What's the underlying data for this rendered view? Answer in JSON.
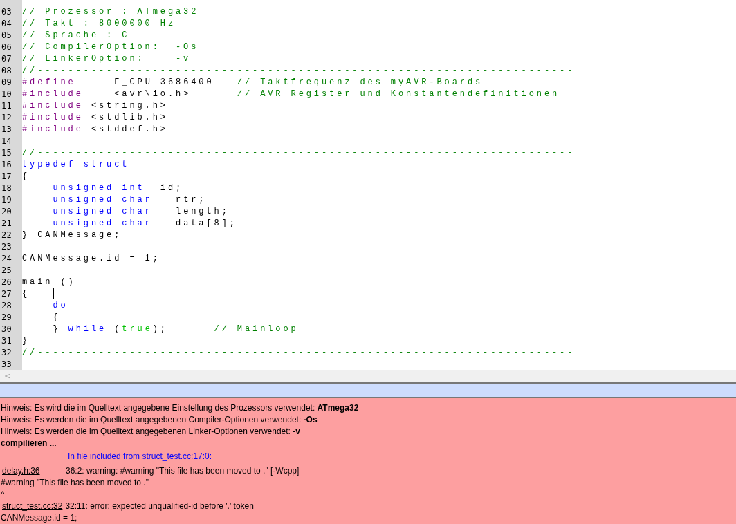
{
  "editor": {
    "lines": [
      {
        "number": "03",
        "cursor": false,
        "tokens": [
          {
            "kind": "comment",
            "text": "// Prozessor : ATmega32"
          }
        ]
      },
      {
        "number": "04",
        "cursor": false,
        "tokens": [
          {
            "kind": "comment",
            "text": "// Takt : 8000000 Hz"
          }
        ]
      },
      {
        "number": "05",
        "cursor": false,
        "tokens": [
          {
            "kind": "comment",
            "text": "// Sprache : C"
          }
        ]
      },
      {
        "number": "06",
        "cursor": false,
        "tokens": [
          {
            "kind": "comment",
            "text": "// CompilerOption:  -Os"
          }
        ]
      },
      {
        "number": "07",
        "cursor": false,
        "tokens": [
          {
            "kind": "comment",
            "text": "// LinkerOption:    -v"
          }
        ]
      },
      {
        "number": "08",
        "cursor": false,
        "tokens": [
          {
            "kind": "comment",
            "text": "//----------------------------------------------------------------------"
          }
        ]
      },
      {
        "number": "09",
        "cursor": false,
        "tokens": [
          {
            "kind": "preprocessor",
            "text": "#define"
          },
          {
            "kind": "plain",
            "text": "     F_CPU 3686400   "
          },
          {
            "kind": "comment",
            "text": "// Taktfrequenz des myAVR-Boards"
          }
        ]
      },
      {
        "number": "10",
        "cursor": false,
        "tokens": [
          {
            "kind": "preprocessor",
            "text": "#include"
          },
          {
            "kind": "plain",
            "text": "    <avr\\io.h>      "
          },
          {
            "kind": "comment",
            "text": "// AVR Register und Konstantendefinitionen"
          }
        ]
      },
      {
        "number": "11",
        "cursor": false,
        "tokens": [
          {
            "kind": "preprocessor",
            "text": "#include"
          },
          {
            "kind": "plain",
            "text": " <string.h>"
          }
        ]
      },
      {
        "number": "12",
        "cursor": false,
        "tokens": [
          {
            "kind": "preprocessor",
            "text": "#include"
          },
          {
            "kind": "plain",
            "text": " <stdlib.h>"
          }
        ]
      },
      {
        "number": "13",
        "cursor": false,
        "tokens": [
          {
            "kind": "preprocessor",
            "text": "#include"
          },
          {
            "kind": "plain",
            "text": " <stddef.h>"
          }
        ]
      },
      {
        "number": "14",
        "cursor": false
      },
      {
        "number": "15",
        "cursor": false,
        "tokens": [
          {
            "kind": "comment",
            "text": "//----------------------------------------------------------------------"
          }
        ]
      },
      {
        "number": "16",
        "cursor": false,
        "tokens": [
          {
            "kind": "keyword",
            "text": "typedef struct"
          }
        ]
      },
      {
        "number": "17",
        "cursor": false,
        "tokens": [
          {
            "kind": "plain",
            "text": "{"
          }
        ]
      },
      {
        "number": "18",
        "cursor": false,
        "tokens": [
          {
            "kind": "keyword",
            "text": "    unsigned int"
          },
          {
            "kind": "plain",
            "text": "  id;"
          }
        ]
      },
      {
        "number": "19",
        "cursor": false,
        "tokens": [
          {
            "kind": "keyword",
            "text": "    unsigned char"
          },
          {
            "kind": "plain",
            "text": "   rtr;"
          }
        ]
      },
      {
        "number": "20",
        "cursor": false,
        "tokens": [
          {
            "kind": "keyword",
            "text": "    unsigned char"
          },
          {
            "kind": "plain",
            "text": "   length;"
          }
        ]
      },
      {
        "number": "21",
        "cursor": false,
        "tokens": [
          {
            "kind": "keyword",
            "text": "    unsigned char"
          },
          {
            "kind": "plain",
            "text": "   data[8];"
          }
        ]
      },
      {
        "number": "22",
        "cursor": false,
        "tokens": [
          {
            "kind": "plain",
            "text": "} CANMessage;"
          }
        ]
      },
      {
        "number": "23",
        "cursor": false
      },
      {
        "number": "24",
        "cursor": false,
        "tokens": [
          {
            "kind": "plain",
            "text": "CANMessage.id = 1;"
          }
        ]
      },
      {
        "number": "25",
        "cursor": false
      },
      {
        "number": "26",
        "cursor": false,
        "tokens": [
          {
            "kind": "plain",
            "text": "main ()"
          }
        ]
      },
      {
        "number": "27",
        "cursor": true,
        "tokens": [
          {
            "kind": "plain",
            "text": "{   "
          }
        ]
      },
      {
        "number": "28",
        "cursor": false,
        "tokens": [
          {
            "kind": "keyword",
            "text": "    do"
          }
        ]
      },
      {
        "number": "29",
        "cursor": false,
        "tokens": [
          {
            "kind": "plain",
            "text": "    {"
          }
        ]
      },
      {
        "number": "30",
        "cursor": false,
        "tokens": [
          {
            "kind": "plain",
            "text": "    } "
          },
          {
            "kind": "keyword",
            "text": "while"
          },
          {
            "kind": "plain",
            "text": " ("
          },
          {
            "kind": "literal",
            "text": "true"
          },
          {
            "kind": "plain",
            "text": ");      "
          },
          {
            "kind": "comment",
            "text": "// Mainloop"
          }
        ]
      },
      {
        "number": "31",
        "cursor": false,
        "tokens": [
          {
            "kind": "plain",
            "text": "}"
          }
        ]
      },
      {
        "number": "32",
        "cursor": false,
        "tokens": [
          {
            "kind": "comment",
            "text": "//----------------------------------------------------------------------"
          }
        ]
      },
      {
        "number": "33",
        "cursor": false
      }
    ],
    "scroll_left": "<"
  },
  "messages": [
    {
      "kind": "note",
      "text": "Hinweis: Es wird die im Quelltext angegebene Einstellung des Prozessors verwendet: **ATmega32**"
    },
    {
      "kind": "note",
      "text": "Hinweis: Es werden die im Quelltext angegebenen Compiler-Optionen verwendet: **-Os**"
    },
    {
      "kind": "note",
      "text": "Hinweis: Es werden die im Quelltext angegebenen Linker-Optionen verwendet: **-v**"
    },
    {
      "kind": "status",
      "text": "compilieren ..."
    },
    {
      "kind": "info",
      "text": "In file included from struct_test.cc:17:0:"
    },
    {
      "kind": "diagnostic",
      "location": "delay.h:36",
      "text": "36:2: warning: #warning \"This file has been moved to .\" [-Wcpp]"
    },
    {
      "kind": "note",
      "text": "#warning \"This file has been moved to .\""
    },
    {
      "kind": "note",
      "text": "^"
    },
    {
      "kind": "diagnostic",
      "location": "struct_test.cc:32",
      "text": "32:11: error: expected unqualified-id before '.' token"
    },
    {
      "kind": "note",
      "text": "CANMessage.id = 1;"
    }
  ]
}
